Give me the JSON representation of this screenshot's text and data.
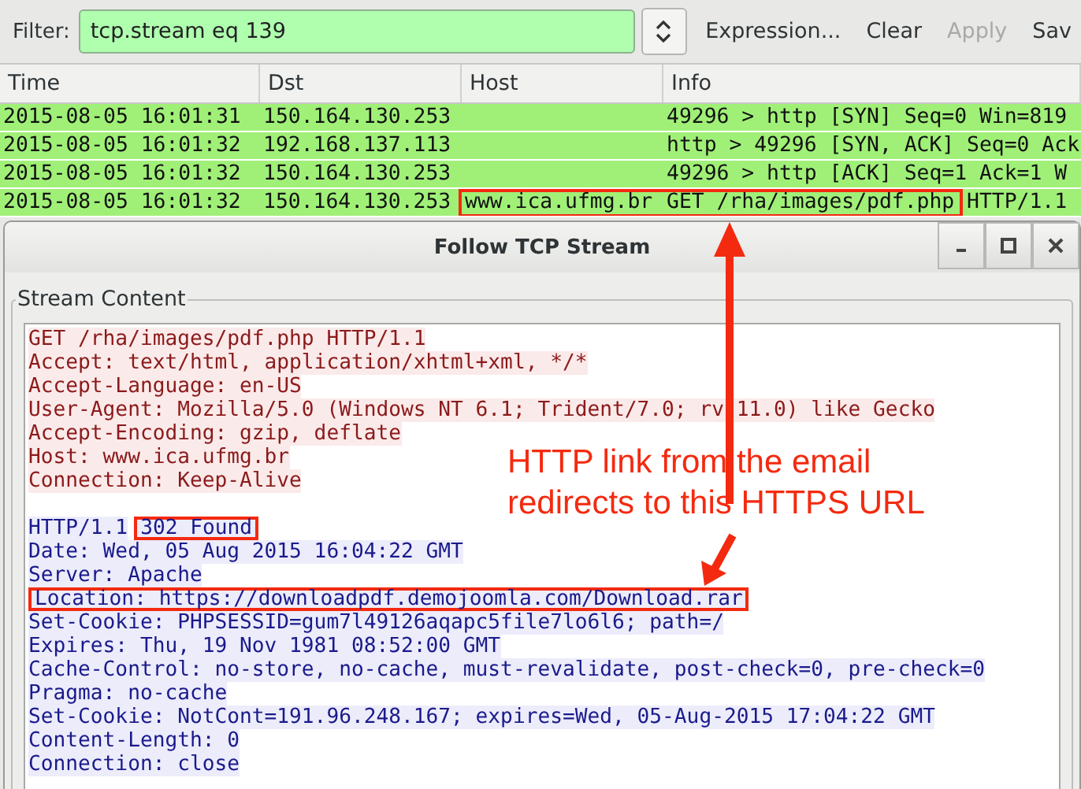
{
  "filter_bar": {
    "label": "Filter:",
    "value": "tcp.stream eq 139",
    "buttons": [
      {
        "label": "Expression...",
        "disabled": false
      },
      {
        "label": "Clear",
        "disabled": false
      },
      {
        "label": "Apply",
        "disabled": true
      },
      {
        "label": "Sav",
        "disabled": false
      }
    ]
  },
  "packet_list": {
    "columns": [
      "Time",
      "Dst",
      "Host",
      "Info"
    ],
    "rows": [
      {
        "time": "2015-08-05 16:01:31",
        "dst": "150.164.130.253",
        "host": "",
        "info": "49296 > http [SYN] Seq=0 Win=819",
        "boxed": false
      },
      {
        "time": "2015-08-05 16:01:32",
        "dst": "192.168.137.113",
        "host": "",
        "info": "http > 49296 [SYN, ACK] Seq=0 Ack",
        "boxed": false
      },
      {
        "time": "2015-08-05 16:01:32",
        "dst": "150.164.130.253",
        "host": "",
        "info": "49296 > http [ACK] Seq=1 Ack=1 W",
        "boxed": false
      },
      {
        "time": "2015-08-05 16:01:32",
        "dst": "150.164.130.253",
        "host": "www.ica.ufmg.br",
        "info": "GET /rha/images/pdf.php HTTP/1.1",
        "boxed": true
      }
    ]
  },
  "dialog": {
    "title": "Follow TCP Stream",
    "group_label": "Stream Content",
    "lines": [
      {
        "kind": "request",
        "segments": [
          {
            "text": "GET /rha/images/pdf.php HTTP/1.1",
            "boxed": false
          }
        ]
      },
      {
        "kind": "request",
        "segments": [
          {
            "text": "Accept: text/html, application/xhtml+xml, */*",
            "boxed": false
          }
        ]
      },
      {
        "kind": "request",
        "segments": [
          {
            "text": "Accept-Language: en-US",
            "boxed": false
          }
        ]
      },
      {
        "kind": "request",
        "segments": [
          {
            "text": "User-Agent: Mozilla/5.0 (Windows NT 6.1; Trident/7.0; rv:11.0) like Gecko",
            "boxed": false
          }
        ]
      },
      {
        "kind": "request",
        "segments": [
          {
            "text": "Accept-Encoding: gzip, deflate",
            "boxed": false
          }
        ]
      },
      {
        "kind": "request",
        "segments": [
          {
            "text": "Host: www.ica.ufmg.br",
            "boxed": false
          }
        ]
      },
      {
        "kind": "request",
        "segments": [
          {
            "text": "Connection: Keep-Alive",
            "boxed": false
          }
        ]
      },
      {
        "kind": "blank"
      },
      {
        "kind": "response",
        "segments": [
          {
            "text": "HTTP/1.1",
            "boxed": false
          },
          {
            "text": "302 Found",
            "boxed": true
          }
        ]
      },
      {
        "kind": "response",
        "segments": [
          {
            "text": "Date: Wed, 05 Aug 2015 16:04:22 GMT",
            "boxed": false
          }
        ]
      },
      {
        "kind": "response",
        "segments": [
          {
            "text": "Server: Apache",
            "boxed": false
          }
        ]
      },
      {
        "kind": "response",
        "segments": [
          {
            "text": "Location: https://downloadpdf.demojoomla.com/Download.rar",
            "boxed": true
          }
        ]
      },
      {
        "kind": "response",
        "segments": [
          {
            "text": "Set-Cookie: PHPSESSID=gum7l49126aqapc5file7lo6l6; path=/",
            "boxed": false
          }
        ]
      },
      {
        "kind": "response",
        "segments": [
          {
            "text": "Expires: Thu, 19 Nov 1981 08:52:00 GMT",
            "boxed": false
          }
        ]
      },
      {
        "kind": "response",
        "segments": [
          {
            "text": "Cache-Control: no-store, no-cache, must-revalidate, post-check=0, pre-check=0",
            "boxed": false
          }
        ]
      },
      {
        "kind": "response",
        "segments": [
          {
            "text": "Pragma: no-cache",
            "boxed": false
          }
        ]
      },
      {
        "kind": "response",
        "segments": [
          {
            "text": "Set-Cookie: NotCont=191.96.248.167; expires=Wed, 05-Aug-2015 17:04:22 GMT",
            "boxed": false
          }
        ]
      },
      {
        "kind": "response",
        "segments": [
          {
            "text": "Content-Length: 0",
            "boxed": false
          }
        ]
      },
      {
        "kind": "response",
        "segments": [
          {
            "text": "Connection: close",
            "boxed": false
          }
        ]
      }
    ]
  },
  "annotation": {
    "lines": [
      "HTTP link from the email",
      "redirects to this HTTPS URL"
    ]
  }
}
